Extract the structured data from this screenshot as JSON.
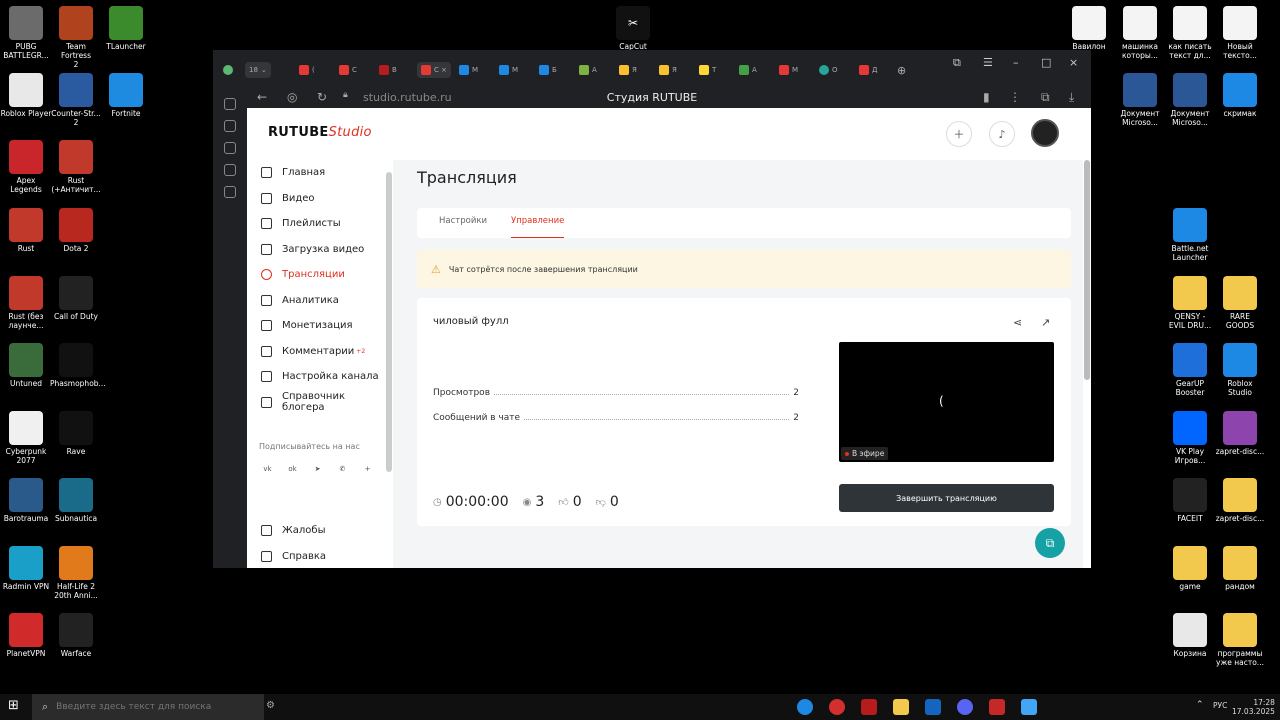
{
  "desktop_left": [
    {
      "label": "PUBG\nBATTLEGR...",
      "color": "#6b6b6b"
    },
    {
      "label": "Team Fortress\n2",
      "color": "#b0421e"
    },
    {
      "label": "TLauncher",
      "color": "#3b8a2b"
    },
    {
      "label": "Roblox Player",
      "color": "#e8e8e8"
    },
    {
      "label": "Counter-Str...\n2",
      "color": "#2a5aa0"
    },
    {
      "label": "Fortnite",
      "color": "#1e8ae0"
    },
    {
      "label": "Apex\nLegends",
      "color": "#c8262a"
    },
    {
      "label": "Rust\n(+Античит...",
      "color": "#c0392b"
    },
    {
      "label": "Rust",
      "color": "#c0392b"
    },
    {
      "label": "Dota 2",
      "color": "#b8281e"
    },
    {
      "label": "Rust (без\nлаунче...",
      "color": "#c0392b"
    },
    {
      "label": "Call of Duty",
      "color": "#222222"
    },
    {
      "label": "Untuned",
      "color": "#3a6b3a"
    },
    {
      "label": "Phasmophob...",
      "color": "#111111"
    },
    {
      "label": "Cyberpunk\n2077",
      "color": "#f0f0f0"
    },
    {
      "label": "Rave",
      "color": "#111111"
    },
    {
      "label": "Barotrauma",
      "color": "#2a5a8a"
    },
    {
      "label": "Subnautica",
      "color": "#1a6a8a"
    },
    {
      "label": "Radmin VPN",
      "color": "#1aa0c8"
    },
    {
      "label": "Half-Life 2\n20th Anni...",
      "color": "#e07a1a"
    },
    {
      "label": "PlanetVPN",
      "color": "#d02a2a"
    },
    {
      "label": "Warface",
      "color": "#222222"
    }
  ],
  "desktop_top": {
    "label": "CapCut",
    "color": "#111111"
  },
  "desktop_right": [
    {
      "label": "Вавилон",
      "color": "#f4f4f4"
    },
    {
      "label": "машинка\nкоторы...",
      "color": "#f4f4f4"
    },
    {
      "label": "как писать\nтекст дл...",
      "color": "#f4f4f4"
    },
    {
      "label": "Новый\nтексто...",
      "color": "#f4f4f4"
    },
    {
      "label": "Документ\nMicroso...",
      "color": "#2b5797"
    },
    {
      "label": "Документ\nMicroso...",
      "color": "#2b5797"
    },
    {
      "label": "скримак",
      "color": "#1e88e5"
    },
    {
      "label": "Battle.net\nLauncher",
      "color": "#1e88e5"
    },
    {
      "label": "QENSY -\nEVIL DRU...",
      "color": "#f2c94c"
    },
    {
      "label": "RARE\nGOODS",
      "color": "#f2c94c"
    },
    {
      "label": "GearUP\nBooster",
      "color": "#1e6fd9"
    },
    {
      "label": "Roblox\nStudio",
      "color": "#1e88e5"
    },
    {
      "label": "VK Play\nИгров...",
      "color": "#0066ff"
    },
    {
      "label": "zapret-disc...",
      "color": "#8e44ad"
    },
    {
      "label": "FACEIT",
      "color": "#222222"
    },
    {
      "label": "zapret-disc...",
      "color": "#f2c94c"
    },
    {
      "label": "game",
      "color": "#f2c94c"
    },
    {
      "label": "рандом",
      "color": "#f2c94c"
    },
    {
      "label": "Корзина",
      "color": "#e8e8e8"
    },
    {
      "label": "программы\nуже насто...",
      "color": "#f2c94c"
    }
  ],
  "browser": {
    "url": "studio.rutube.ru",
    "page_title": "Студия RUTUBE",
    "tab_count": "18"
  },
  "studio": {
    "logo_main": "RUTUBE",
    "logo_sub": "Studio",
    "accent": "#e0301e"
  },
  "sidebar": {
    "items": [
      {
        "label": "Главная",
        "icon": "home-icon"
      },
      {
        "label": "Видео",
        "icon": "video-icon"
      },
      {
        "label": "Плейлисты",
        "icon": "playlist-icon"
      },
      {
        "label": "Загрузка видео",
        "icon": "upload-icon"
      },
      {
        "label": "Трансляции",
        "icon": "broadcast-icon",
        "active": true
      },
      {
        "label": "Аналитика",
        "icon": "analytics-icon"
      },
      {
        "label": "Монетизация",
        "icon": "money-icon"
      },
      {
        "label": "Комментарии",
        "icon": "comments-icon",
        "badge": "+2"
      },
      {
        "label": "Настройка канала",
        "icon": "settings-icon"
      },
      {
        "label": "Справочник блогера",
        "icon": "book-icon"
      }
    ],
    "follow_label": "Подписывайтесь на нас",
    "bottom": [
      {
        "label": "Жалобы",
        "icon": "flag-icon"
      },
      {
        "label": "Справка",
        "icon": "help-icon"
      }
    ]
  },
  "main": {
    "title": "Трансляция",
    "tabs": [
      "Настройки",
      "Управление"
    ],
    "warning": "Чат сотрётся после завершения трансляции",
    "stream_title": "чиловый фулл",
    "stats": [
      {
        "label": "Просмотров",
        "value": "2"
      },
      {
        "label": "Сообщений в чате",
        "value": "2"
      }
    ],
    "live_label": "В эфире",
    "duration": "00:00:00",
    "viewers": "3",
    "likes": "0",
    "dislikes": "0",
    "end_button": "Завершить трансляцию"
  },
  "taskbar": {
    "search_placeholder": "Введите здесь текст для поиска",
    "lang": "РУС",
    "time": "17:28",
    "date": "17.03.2025"
  }
}
